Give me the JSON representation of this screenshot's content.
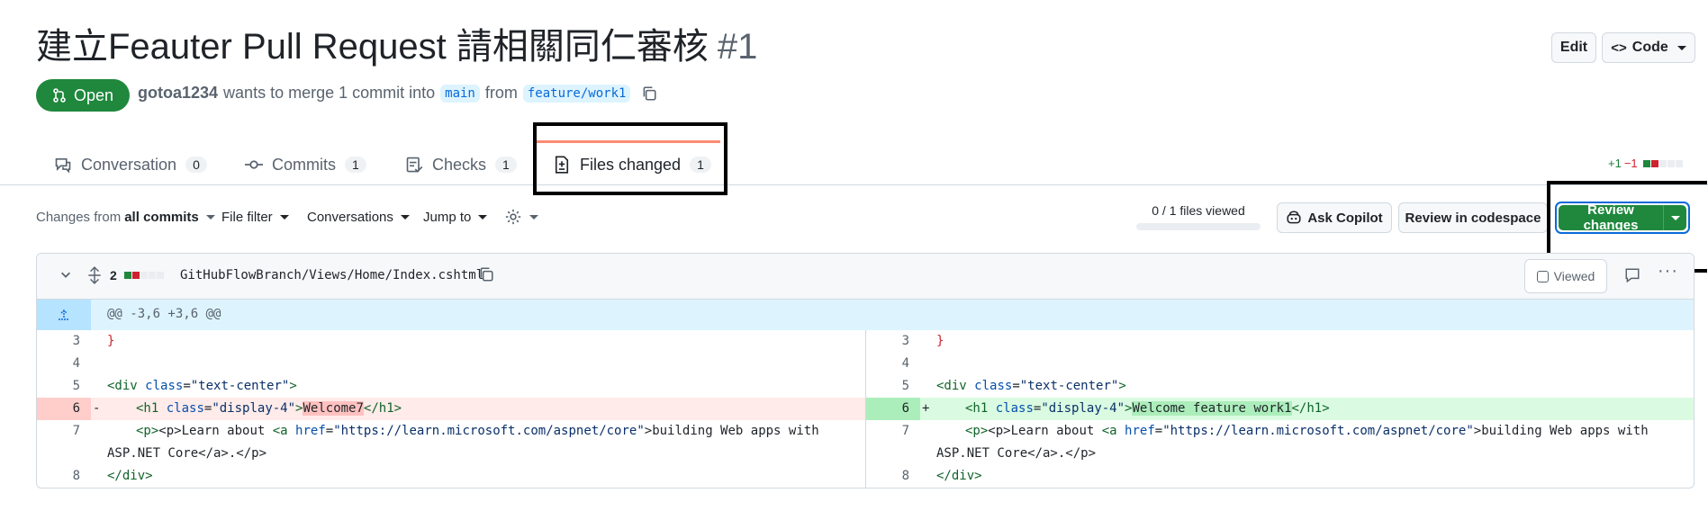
{
  "pr": {
    "title": "建立Feauter Pull Request 請相關同仁審核",
    "number": "#1",
    "state": "Open",
    "author": "gotoa1234",
    "merge_text": "wants to merge 1 commit into",
    "base_branch": "main",
    "from_text": "from",
    "head_branch": "feature/work1"
  },
  "header_buttons": {
    "edit": "Edit",
    "code": "Code"
  },
  "tabs": [
    {
      "label": "Conversation",
      "count": "0"
    },
    {
      "label": "Commits",
      "count": "1"
    },
    {
      "label": "Checks",
      "count": "1"
    },
    {
      "label": "Files changed",
      "count": "1"
    }
  ],
  "diffstat": {
    "added": "+1",
    "removed": "−1"
  },
  "toolbar": {
    "changes_from_prefix": "Changes from",
    "changes_from_value": "all commits",
    "file_filter": "File filter",
    "conversations": "Conversations",
    "jump_to": "Jump to",
    "files_viewed": "0 / 1 files viewed",
    "ask_copilot": "Ask Copilot",
    "review_codespace": "Review in codespace",
    "review_changes": "Review changes"
  },
  "file": {
    "changes": "2",
    "path": "GitHubFlowBranch/Views/Home/Index.cshtml",
    "viewed_label": "Viewed",
    "hunk": "@@ -3,6 +3,6 @@"
  },
  "diff_left": {
    "lines": [
      {
        "num": "3",
        "sign": ""
      },
      {
        "num": "4",
        "sign": ""
      },
      {
        "num": "5",
        "sign": ""
      },
      {
        "num": "6",
        "sign": "-"
      },
      {
        "num": "7",
        "sign": ""
      },
      {
        "num": "",
        "sign": ""
      },
      {
        "num": "8",
        "sign": ""
      }
    ],
    "del_text": "Welcome7"
  },
  "diff_right": {
    "lines": [
      {
        "num": "3",
        "sign": ""
      },
      {
        "num": "4",
        "sign": ""
      },
      {
        "num": "5",
        "sign": ""
      },
      {
        "num": "6",
        "sign": "+"
      },
      {
        "num": "7",
        "sign": ""
      },
      {
        "num": "",
        "sign": ""
      },
      {
        "num": "8",
        "sign": ""
      }
    ],
    "add_text": "Welcome feature work1"
  },
  "code": {
    "brace": "}",
    "div_open_tag": "<div",
    "div_class_attr": "class",
    "div_class_val": "\"text-center\"",
    "h1_open": "<h1",
    "h1_class_attr": "class",
    "h1_class_val": "\"display-4\"",
    "h1_close": "</h1>",
    "p_line_start": "<p>Learn about ",
    "a_open": "<a",
    "href_attr": "href",
    "href_val": "\"https://learn.microsoft.com/aspnet/core\"",
    "p_line_end": ">building Web apps with",
    "p_wrap": "ASP.NET Core</a>.</p>",
    "div_close": "</div>"
  },
  "colors": {
    "open_green": "#1f883d",
    "link_blue": "#0969da",
    "add_bg": "#dafbe1",
    "del_bg": "#ffebe9",
    "hunk_bg": "#ddf4ff"
  }
}
